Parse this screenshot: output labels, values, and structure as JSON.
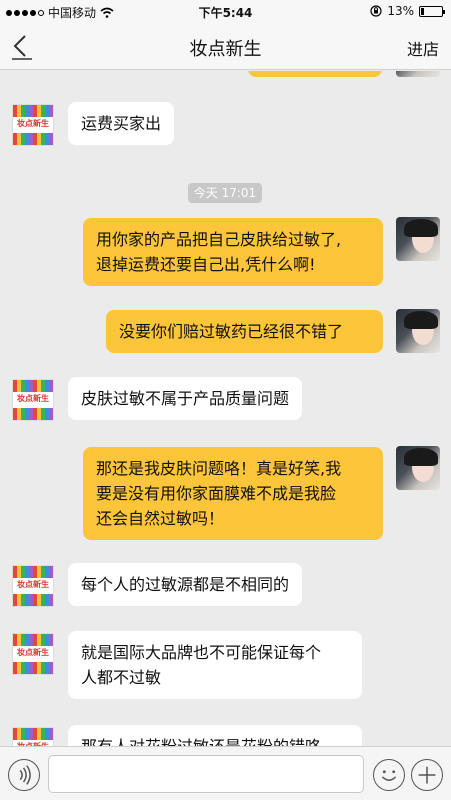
{
  "status_bar": {
    "carrier": "中国移动",
    "time": "下午5:44",
    "battery_percent": "13%",
    "battery_level": 0.13,
    "icons": [
      "signal-dots-icon",
      "wifi-icon",
      "rotation-lock-icon",
      "battery-icon"
    ]
  },
  "nav": {
    "title": "妆点新生",
    "action": "进店",
    "back_icon": "chevron-left-icon"
  },
  "chat": {
    "shop_logo_text": "妆点新生",
    "time_separator": "今天 17:01",
    "messages": [
      {
        "from": "shop",
        "text": "运费买家出"
      },
      {
        "from": "user",
        "text_lines": [
          "用你家的产品把自己皮肤给过敏了,",
          "退掉运费还要自己出,凭什么啊!"
        ]
      },
      {
        "from": "user",
        "text": "没要你们赔过敏药已经很不错了"
      },
      {
        "from": "shop",
        "text": "皮肤过敏不属于产品质量问题"
      },
      {
        "from": "user",
        "text_lines": [
          "那还是我皮肤问题咯！真是好笑,我",
          "要是没有用你家面膜难不成是我脸",
          "还会自然过敏吗！"
        ]
      },
      {
        "from": "shop",
        "text": "每个人的过敏源都是不相同的"
      },
      {
        "from": "shop",
        "text_lines": [
          "就是国际大品牌也不可能保证每个",
          "人都不过敏"
        ]
      },
      {
        "from": "shop",
        "text": "那有人对花粉过敏还是花粉的错咯"
      }
    ]
  },
  "input_bar": {
    "voice_icon": "voice-icon",
    "emoji_icon": "emoji-icon",
    "plus_icon": "plus-icon",
    "placeholder": ""
  }
}
